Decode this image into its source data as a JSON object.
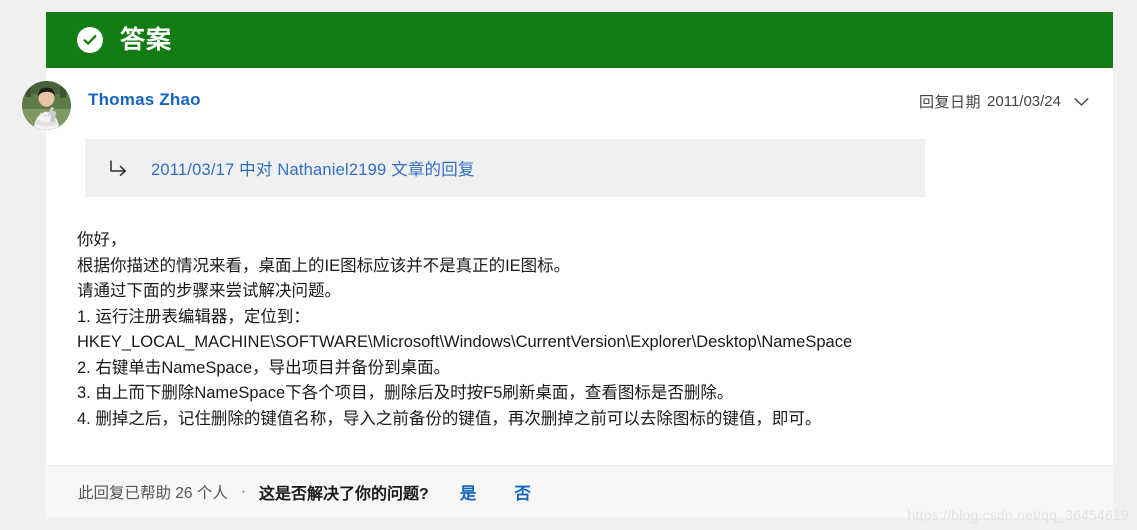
{
  "colors": {
    "header_green": "#137c13",
    "link_blue": "#1666c0",
    "quote_blue": "#2f6fc4",
    "page_background": "#f0f0f0",
    "card_background": "#ffffff",
    "quote_background": "#f0f0f0",
    "footer_background": "#f7f7f7",
    "body_text": "#1a1a1a",
    "muted_text": "#555555",
    "watermark": "#e3e3e3"
  },
  "header": {
    "title": "答案",
    "check_icon": "check-circle-icon"
  },
  "author": {
    "name": "Thomas Zhao",
    "avatar_icon": "user-avatar-photo",
    "reply_date_label": "回复日期",
    "reply_date_value": "2011/03/24",
    "chevron_icon": "chevron-down-icon"
  },
  "quote": {
    "arrow_icon": "reply-arrow-icon",
    "link_text": "2011/03/17 中对 Nathaniel2199 文章的回复"
  },
  "body": {
    "lines": [
      "你好，",
      "根据你描述的情况来看，桌面上的IE图标应该并不是真正的IE图标。",
      "请通过下面的步骤来尝试解决问题。",
      "1. 运行注册表编辑器，定位到：",
      "HKEY_LOCAL_MACHINE\\SOFTWARE\\Microsoft\\Windows\\CurrentVersion\\Explorer\\Desktop\\NameSpace",
      "2. 右键单击NameSpace，导出项目并备份到桌面。",
      "3. 由上而下删除NameSpace下各个项目，删除后及时按F5刷新桌面，查看图标是否删除。",
      "4. 删掉之后，记住删除的键值名称，导入之前备份的键值，再次删掉之前可以去除图标的键值，即可。"
    ]
  },
  "footer": {
    "helpful_count_text": "此回复已帮助 26 个人",
    "dot_separator": "·",
    "solved_prompt": "这是否解决了你的问题?",
    "vote_yes_label": "是",
    "vote_no_label": "否"
  },
  "watermark": {
    "text": "https://blog.csdn.net/qq_36454619"
  }
}
